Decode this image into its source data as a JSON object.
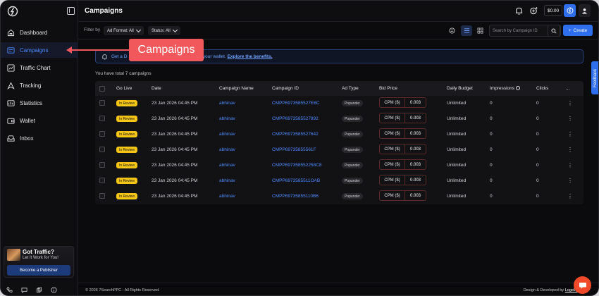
{
  "app": {
    "balance": "$0.00"
  },
  "sidebar": {
    "items": [
      {
        "label": "Dashboard",
        "icon": "home-icon"
      },
      {
        "label": "Campaigns",
        "icon": "campaigns-icon",
        "active": true
      },
      {
        "label": "Traffic Chart",
        "icon": "chart-icon"
      },
      {
        "label": "Tracking",
        "icon": "tracking-icon"
      },
      {
        "label": "Statistics",
        "icon": "statistics-icon"
      },
      {
        "label": "Wallet",
        "icon": "wallet-icon"
      },
      {
        "label": "Inbox",
        "icon": "inbox-icon"
      }
    ],
    "promo": {
      "title": "Got Traffic?",
      "subtitle": "Let It Work for You!",
      "button": "Become a Publisher"
    }
  },
  "header": {
    "title": "Campaigns"
  },
  "filters": {
    "label": "Filter by",
    "ad_format": "Ad Format: All",
    "status": "Status: All",
    "search_placeholder": "Search by Campaign ID",
    "create_label": "Create"
  },
  "notice": {
    "prefix": "Get a D",
    "middle": "more in your wallet.",
    "link": "Explore the benefits."
  },
  "summary": "You have total 7 campaigns",
  "table": {
    "headers": [
      "Go Live",
      "Date",
      "Campaign Name",
      "Campaign ID",
      "Ad Type",
      "Bid Price",
      "Daily Budget",
      "Impressions",
      "Clicks",
      "..."
    ],
    "rows": [
      {
        "status": "In Review",
        "date": "23 Jan 2026 04:45 PM",
        "name": "abhinav",
        "id": "CMPP6973585527E8C",
        "ad_type": "Popunder",
        "bid_label": "CPM ($)",
        "bid_value": "0.003",
        "budget": "Unlimited",
        "impressions": "0",
        "clicks": "0"
      },
      {
        "status": "In Review",
        "date": "23 Jan 2026 04:45 PM",
        "name": "abhinav",
        "id": "CMPP6973585527892",
        "ad_type": "Popunder",
        "bid_label": "CPM ($)",
        "bid_value": "0.003",
        "budget": "Unlimited",
        "impressions": "0",
        "clicks": "0"
      },
      {
        "status": "In Review",
        "date": "23 Jan 2026 04:45 PM",
        "name": "abhinav",
        "id": "CMPP6973585527642",
        "ad_type": "Popunder",
        "bid_label": "CPM ($)",
        "bid_value": "0.003",
        "budget": "Unlimited",
        "impressions": "0",
        "clicks": "0"
      },
      {
        "status": "In Review",
        "date": "23 Jan 2026 04:45 PM",
        "name": "abhinav",
        "id": "CMPP69735855561F",
        "ad_type": "Popunder",
        "bid_label": "CPM ($)",
        "bid_value": "0.003",
        "budget": "Unlimited",
        "impressions": "0",
        "clicks": "0"
      },
      {
        "status": "In Review",
        "date": "23 Jan 2026 04:45 PM",
        "name": "abhinav",
        "id": "CMPP697358552258C8",
        "ad_type": "Popunder",
        "bid_label": "CPM ($)",
        "bid_value": "0.003",
        "budget": "Unlimited",
        "impressions": "0",
        "clicks": "0"
      },
      {
        "status": "In Review",
        "date": "23 Jan 2026 04:45 PM",
        "name": "abhinav",
        "id": "CMPP6973585511OAB",
        "ad_type": "Popunder",
        "bid_label": "CPM ($)",
        "bid_value": "0.003",
        "budget": "Unlimited",
        "impressions": "0",
        "clicks": "0"
      },
      {
        "status": "In Review",
        "date": "23 Jan 2026 04:45 PM",
        "name": "abhinav",
        "id": "CMPP69735855110B6",
        "ad_type": "Popunder",
        "bid_label": "CPM ($)",
        "bid_value": "0.003",
        "budget": "Unlimited",
        "impressions": "0",
        "clicks": "0"
      }
    ]
  },
  "footer": {
    "copyright": "© 2026 7SearchPPC",
    "rights": " - All Rights Reserved.",
    "credit": "Design & Developed by ",
    "credit_link": "Logelite"
  },
  "feedback": "Feedback",
  "annotation": {
    "label": "Campaigns"
  },
  "colors": {
    "accent": "#2f6fed",
    "link": "#4f8bff",
    "badge": "#f5c518",
    "annotation": "#f0585b"
  }
}
